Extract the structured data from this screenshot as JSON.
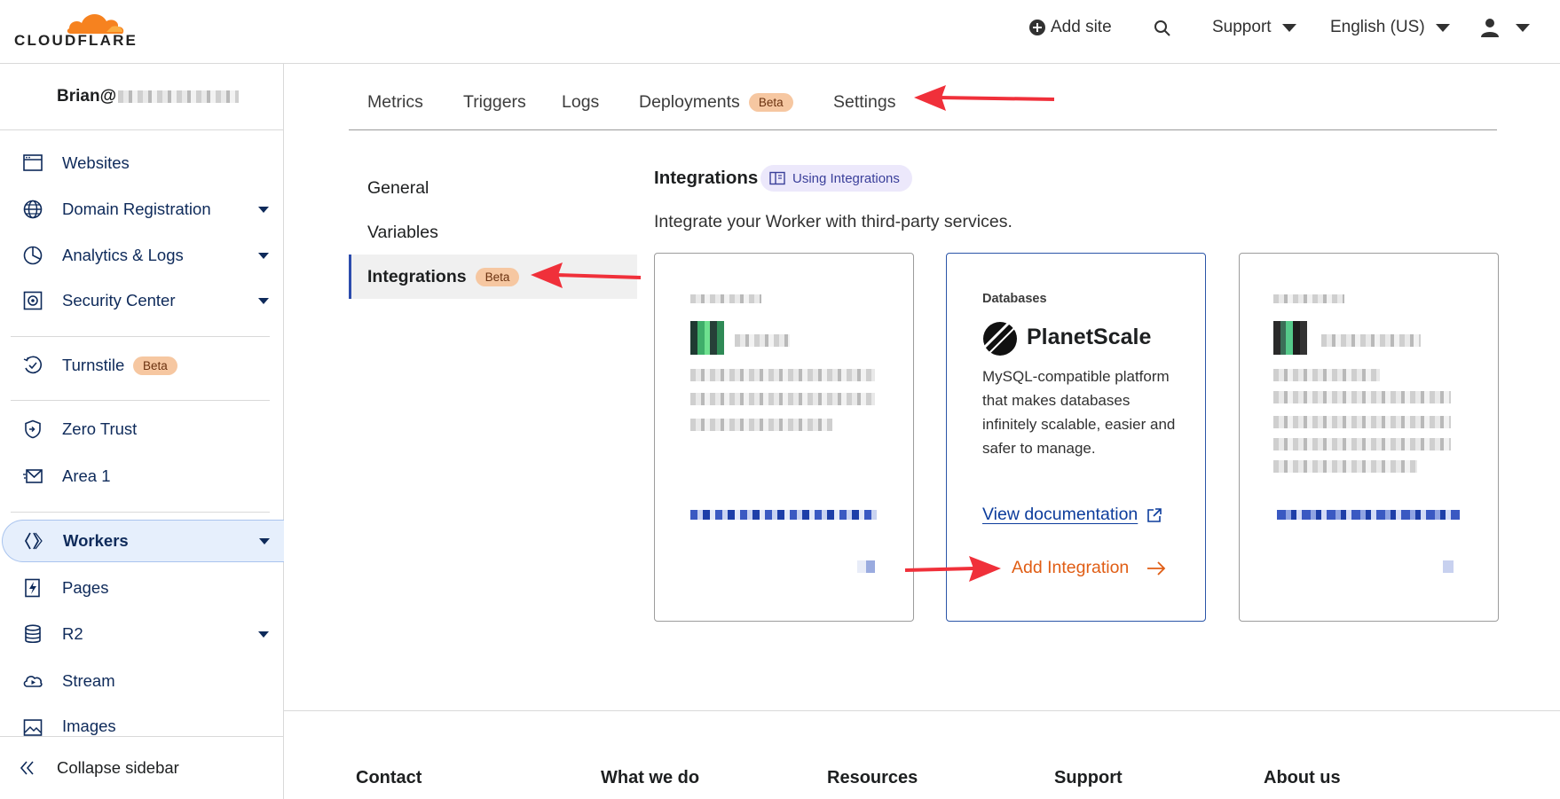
{
  "header": {
    "logo_text": "CLOUDFLARE",
    "add_site": "Add site",
    "support": "Support",
    "language": "English (US)"
  },
  "sidebar": {
    "account": "Brian@",
    "items": [
      {
        "label": "Websites",
        "icon": "browser-window-icon"
      },
      {
        "label": "Domain Registration",
        "icon": "globe-icon",
        "dropdown": true
      },
      {
        "label": "Analytics & Logs",
        "icon": "pie-chart-icon",
        "dropdown": true
      },
      {
        "label": "Security Center",
        "icon": "security-center-icon",
        "dropdown": true
      },
      {
        "label": "Turnstile",
        "icon": "turnstile-icon",
        "badge": "Beta"
      },
      {
        "label": "Zero Trust",
        "icon": "zero-trust-icon"
      },
      {
        "label": "Area 1",
        "icon": "envelope-icon"
      },
      {
        "label": "Workers",
        "icon": "workers-icon",
        "dropdown": true,
        "active": true
      },
      {
        "label": "Pages",
        "icon": "pages-lightning-icon"
      },
      {
        "label": "R2",
        "icon": "database-icon",
        "dropdown": true
      },
      {
        "label": "Stream",
        "icon": "stream-play-icon"
      },
      {
        "label": "Images",
        "icon": "image-icon"
      }
    ],
    "collapse": "Collapse sidebar"
  },
  "tabs": {
    "metrics": "Metrics",
    "triggers": "Triggers",
    "logs": "Logs",
    "deployments": "Deployments",
    "deployments_badge": "Beta",
    "settings": "Settings",
    "active": "Settings"
  },
  "subnav": {
    "general": "General",
    "variables": "Variables",
    "integrations": "Integrations",
    "integrations_badge": "Beta"
  },
  "integrations": {
    "title": "Integrations",
    "help_pill": "Using Integrations",
    "description": "Integrate your Worker with third-party services.",
    "planetscale": {
      "category": "Databases",
      "name": "PlanetScale",
      "description": "MySQL-compatible platform that makes databases infinitely scalable, easier and safer to manage.",
      "doc_link": "View documentation",
      "add": "Add Integration"
    }
  },
  "footer": {
    "contact": "Contact",
    "what_we_do": "What we do",
    "resources": "Resources",
    "support": "Support",
    "about": "About us"
  },
  "colors": {
    "brand_orange": "#f6821f",
    "nav_blue": "#0e2a5a",
    "link_blue": "#0c3c9c",
    "action_orange": "#e05d14",
    "beta_badge": "#f6c7a1",
    "annotation_red": "#f0303a"
  }
}
